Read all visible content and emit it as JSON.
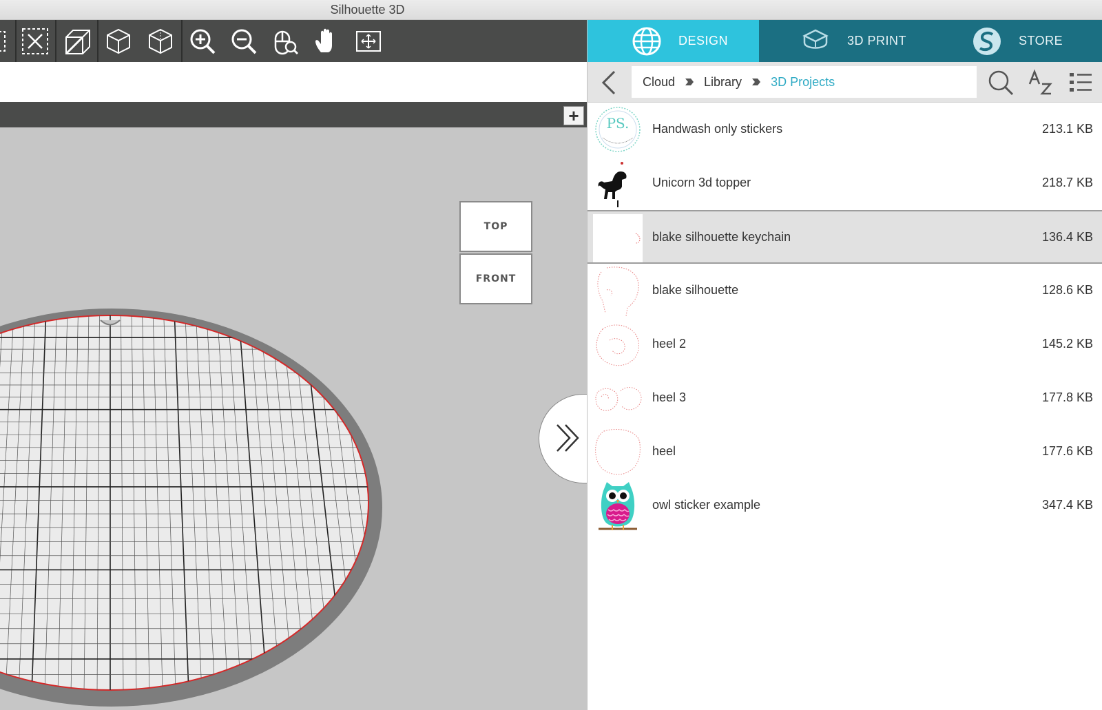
{
  "window": {
    "title": "Silhouette 3D"
  },
  "toolbar": {
    "tools": [
      "select-icon",
      "deselect-icon",
      "extrude-box-icon",
      "cube-view-icon",
      "cube-iso-icon",
      "zoom-in-icon",
      "zoom-out-icon",
      "zoom-select-icon",
      "pan-hand-icon",
      "fit-page-icon"
    ]
  },
  "viewcube": {
    "top_label": "TOP",
    "front_label": "FRONT"
  },
  "panel": {
    "tabs": [
      {
        "label": "DESIGN",
        "icon": "globe-icon",
        "active": true
      },
      {
        "label": "3D PRINT",
        "icon": "printer-box-icon",
        "active": false
      },
      {
        "label": "STORE",
        "icon": "silhouette-s-icon",
        "active": false
      }
    ],
    "breadcrumb": [
      "Cloud",
      "Library",
      "3D Projects"
    ],
    "files": [
      {
        "name": "Handwash only stickers",
        "size": "213.1 KB",
        "thumb": "ps-sticker-thumb",
        "selected": false
      },
      {
        "name": "Unicorn 3d topper",
        "size": "218.7 KB",
        "thumb": "unicorn-thumb",
        "selected": false
      },
      {
        "name": "blake silhouette keychain",
        "size": "136.4 KB",
        "thumb": "keychain-thumb",
        "selected": true
      },
      {
        "name": "blake silhouette",
        "size": "128.6 KB",
        "thumb": "blake-outline-thumb",
        "selected": false
      },
      {
        "name": "heel 2",
        "size": "145.2 KB",
        "thumb": "heel2-thumb",
        "selected": false
      },
      {
        "name": "heel 3",
        "size": "177.8 KB",
        "thumb": "heel3-thumb",
        "selected": false
      },
      {
        "name": "heel",
        "size": "177.6 KB",
        "thumb": "heel-thumb",
        "selected": false
      },
      {
        "name": "owl sticker example",
        "size": "347.4 KB",
        "thumb": "owl-thumb",
        "selected": false
      }
    ]
  },
  "colors": {
    "tab_active": "#2ec3dd",
    "tab_bar": "#1b6f82",
    "toolbar": "#4a4b4a",
    "breadcrumb_current": "#2eaac4",
    "canvas": "#c6c6c6",
    "bed_outline": "#d62828"
  }
}
